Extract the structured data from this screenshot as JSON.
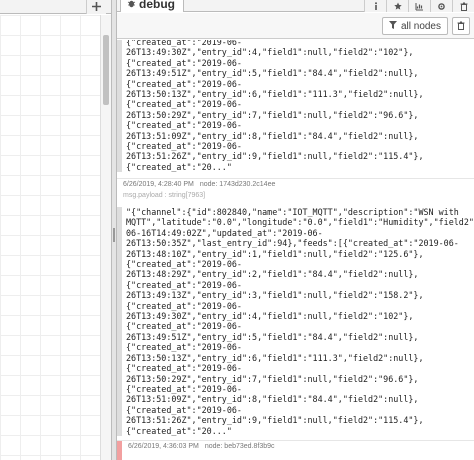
{
  "workspace": {
    "add_icon": "plus-icon"
  },
  "sidebar": {
    "tab": {
      "label": "debug",
      "icon": "bug-icon"
    },
    "tab_icons": [
      "info-icon",
      "bookmark-icon",
      "chart-icon",
      "gear-icon",
      "trash-icon"
    ],
    "filter_label": "all nodes",
    "filter_icon": "filter-icon",
    "clear_icon": "trash-icon"
  },
  "messages": [
    {
      "lines": [
        "{\"created_at\":\"2019-06-",
        "26T13:49:30Z\",\"entry_id\":4,\"field1\":null,\"field2\":\"102\"},",
        "{\"created_at\":\"2019-06-",
        "26T13:49:51Z\",\"entry_id\":5,\"field1\":\"84.4\",\"field2\":null},",
        "{\"created_at\":\"2019-06-",
        "26T13:50:13Z\",\"entry_id\":6,\"field1\":\"111.3\",\"field2\":null},",
        "{\"created_at\":\"2019-06-",
        "26T13:50:29Z\",\"entry_id\":7,\"field1\":null,\"field2\":\"96.6\"},",
        "{\"created_at\":\"2019-06-",
        "26T13:51:09Z\",\"entry_id\":8,\"field1\":\"84.4\",\"field2\":null},",
        "{\"created_at\":\"2019-06-",
        "26T13:51:26Z\",\"entry_id\":9,\"field1\":null,\"field2\":\"115.4\"},",
        "{\"created_at\":\"20...\""
      ]
    },
    {
      "timestamp": "6/26/2019, 4:28:40 PM",
      "node": "node: 1743d230.2c14ee",
      "type": "msg.payload : string[7963]",
      "lines": [
        "\"{\"channel\":{\"id\":802840,\"name\":\"IOT_MQTT\",\"description\":\"WSN with",
        "MQTT\",\"latitude\":\"0.0\",\"longitude\":\"0.0\",\"field1\":\"Humidity\",\"field2\"",
        "06-16T14:49:02Z\",\"updated_at\":\"2019-06-",
        "26T13:50:35Z\",\"last_entry_id\":94},\"feeds\":[{\"created_at\":\"2019-06-",
        "26T13:48:10Z\",\"entry_id\":1,\"field1\":null,\"field2\":\"125.6\"},",
        "{\"created_at\":\"2019-06-",
        "26T13:48:29Z\",\"entry_id\":2,\"field1\":\"84.4\",\"field2\":null},",
        "{\"created_at\":\"2019-06-",
        "26T13:49:13Z\",\"entry_id\":3,\"field1\":null,\"field2\":\"158.2\"},",
        "{\"created_at\":\"2019-06-",
        "26T13:49:30Z\",\"entry_id\":4,\"field1\":null,\"field2\":\"102\"},",
        "{\"created_at\":\"2019-06-",
        "26T13:49:51Z\",\"entry_id\":5,\"field1\":\"84.4\",\"field2\":null},",
        "{\"created_at\":\"2019-06-",
        "26T13:50:13Z\",\"entry_id\":6,\"field1\":\"111.3\",\"field2\":null},",
        "{\"created_at\":\"2019-06-",
        "26T13:50:29Z\",\"entry_id\":7,\"field1\":null,\"field2\":\"96.6\"},",
        "{\"created_at\":\"2019-06-",
        "26T13:51:09Z\",\"entry_id\":8,\"field1\":\"84.4\",\"field2\":null},",
        "{\"created_at\":\"2019-06-",
        "26T13:51:26Z\",\"entry_id\":9,\"field1\":null,\"field2\":\"115.4\"},",
        "{\"created_at\":\"20...\""
      ]
    },
    {
      "timestamp": "6/26/2019, 4:36:03 PM",
      "node": "node: beb73ed.8f3b9c"
    }
  ]
}
